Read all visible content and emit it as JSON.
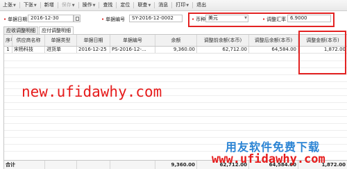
{
  "toolbar": {
    "items": [
      {
        "label": "上张",
        "caret": true,
        "disabled": false
      },
      {
        "label": "下张",
        "caret": true,
        "disabled": false
      },
      {
        "label": "新增",
        "caret": false,
        "disabled": false
      },
      {
        "label": "保存",
        "caret": true,
        "disabled": true
      },
      {
        "label": "操作",
        "caret": true,
        "disabled": false
      },
      {
        "label": "查找",
        "caret": false,
        "disabled": false
      },
      {
        "label": "定位",
        "caret": false,
        "disabled": false
      },
      {
        "label": "联查",
        "caret": true,
        "disabled": false
      },
      {
        "label": "消息",
        "caret": false,
        "disabled": false
      },
      {
        "label": "打印",
        "caret": true,
        "disabled": false
      },
      {
        "label": "退出",
        "caret": false,
        "disabled": false
      }
    ]
  },
  "form": {
    "date_label": "单据日期",
    "date_value": "2016-12-30",
    "number_label": "单据编号",
    "number_value": "SY-2016-12-0002",
    "currency_label": "币种",
    "currency_value": "美元",
    "rate_label": "调整汇率",
    "rate_value": "6.9000"
  },
  "tabs": [
    {
      "label": "应收调整明细",
      "active": false
    },
    {
      "label": "应付调整明细",
      "active": true
    }
  ],
  "grid": {
    "headers": [
      "序号",
      "供应商名称",
      "单据类型",
      "单据日期",
      "单据编号",
      "余额",
      "调整前余额(本币)",
      "调整后余额(本币)",
      "调整金额(本币)"
    ],
    "rows": [
      [
        "1",
        "宋杨科技",
        "进货单",
        "2016-12-25",
        "PS-2016-12-...",
        "9,360.00",
        "62,712.00",
        "64,584.00",
        "1,872.00"
      ]
    ],
    "total_label": "合计",
    "totals": [
      "",
      "",
      "",
      "",
      "",
      "9,360.00",
      "62,712.00",
      "64,584.00",
      "1,872.00"
    ]
  },
  "watermarks": {
    "url_big": "new.ufidawhy.com",
    "brand": "用友软件免费下载",
    "url_small": "www.ufidawhy.com"
  },
  "colors": {
    "highlight": "#e32222",
    "watermark_red": "#e61b1b",
    "watermark_blue": "#2b84d4"
  }
}
